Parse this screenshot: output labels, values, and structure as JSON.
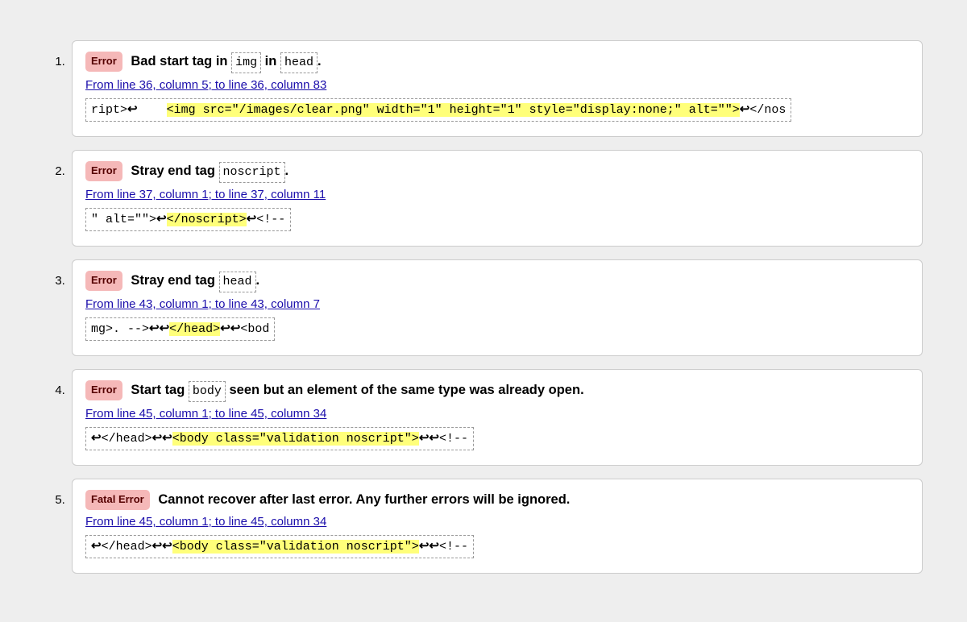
{
  "badge_error": "Error",
  "badge_fatal": "Fatal Error",
  "items": [
    {
      "type": "error",
      "msg_parts": [
        "Bad start tag in ",
        {
          "code": "img"
        },
        " in ",
        {
          "code": "head"
        },
        "."
      ],
      "location": "From line 36, column 5; to line 36, column 83",
      "src": {
        "pre": "ript>↩    ",
        "hl": "<img src=\"/images/clear.png\" width=\"1\" height=\"1\" style=\"display:none;\" alt=\"\">",
        "post": "↩</nos"
      }
    },
    {
      "type": "error",
      "msg_parts": [
        "Stray end tag ",
        {
          "code": "noscript"
        },
        "."
      ],
      "location": "From line 37, column 1; to line 37, column 11",
      "src": {
        "pre": "\" alt=\"\">↩",
        "hl": "</noscript>",
        "post": "↩<!--"
      }
    },
    {
      "type": "error",
      "msg_parts": [
        "Stray end tag ",
        {
          "code": "head"
        },
        "."
      ],
      "location": "From line 43, column 1; to line 43, column 7",
      "src": {
        "pre": "mg>. -->↩↩",
        "hl": "</head>",
        "post": "↩↩<bod"
      }
    },
    {
      "type": "error",
      "msg_parts": [
        "Start tag ",
        {
          "code": "body"
        },
        " seen but an element of the same type was already open."
      ],
      "location": "From line 45, column 1; to line 45, column 34",
      "src": {
        "pre": "↩</head>↩↩",
        "hl": "<body class=\"validation noscript\">",
        "post": "↩↩<!--"
      }
    },
    {
      "type": "fatal",
      "msg_parts": [
        "Cannot recover after last error. Any further errors will be ignored."
      ],
      "location": "From line 45, column 1; to line 45, column 34",
      "src": {
        "pre": "↩</head>↩↩",
        "hl": "<body class=\"validation noscript\">",
        "post": "↩↩<!--"
      }
    }
  ]
}
